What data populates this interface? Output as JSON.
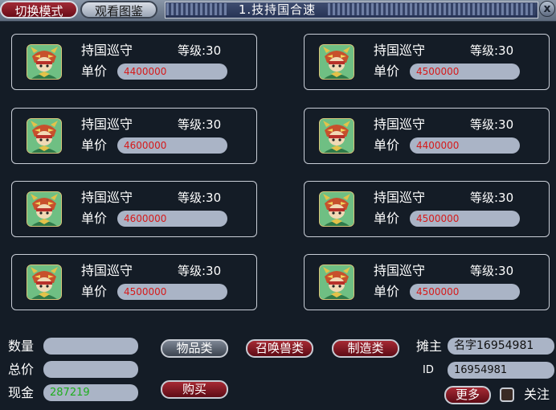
{
  "header": {
    "switch_mode": "切换模式",
    "view_catalog": "观看图鉴",
    "title": "1.技持国合速",
    "close": "x"
  },
  "items": [
    {
      "name": "持国巡守",
      "level_label": "等级:30",
      "price_label": "单价",
      "price": "4400000"
    },
    {
      "name": "持国巡守",
      "level_label": "等级:30",
      "price_label": "单价",
      "price": "4500000"
    },
    {
      "name": "持国巡守",
      "level_label": "等级:30",
      "price_label": "单价",
      "price": "4600000"
    },
    {
      "name": "持国巡守",
      "level_label": "等级:30",
      "price_label": "单价",
      "price": "4400000"
    },
    {
      "name": "持国巡守",
      "level_label": "等级:30",
      "price_label": "单价",
      "price": "4600000"
    },
    {
      "name": "持国巡守",
      "level_label": "等级:30",
      "price_label": "单价",
      "price": "4500000"
    },
    {
      "name": "持国巡守",
      "level_label": "等级:30",
      "price_label": "单价",
      "price": "4500000"
    },
    {
      "name": "持国巡守",
      "level_label": "等级:30",
      "price_label": "单价",
      "price": "4500000"
    }
  ],
  "form": {
    "quantity_label": "数量",
    "quantity_value": "",
    "total_label": "总价",
    "total_value": "",
    "cash_label": "现金",
    "cash_value": "287219"
  },
  "categories": {
    "items": "物品类",
    "summon": "召唤兽类",
    "crafting": "制造类"
  },
  "buy_label": "购买",
  "stall": {
    "owner_label": "摊主",
    "owner_value": "名字16954981",
    "id_label": "ID",
    "id_value": "16954981"
  },
  "more_label": "更多",
  "follow_label": "关注",
  "colors": {
    "background": "#141c26",
    "field": "#aab4c6",
    "price_text": "#d61a1a",
    "cash_text": "#1fae1f",
    "red_button": "#8a1a24",
    "gray_button": "#5c6470"
  },
  "icons": {
    "portrait": "dragon-warrior-portrait-icon",
    "close": "close-icon"
  }
}
